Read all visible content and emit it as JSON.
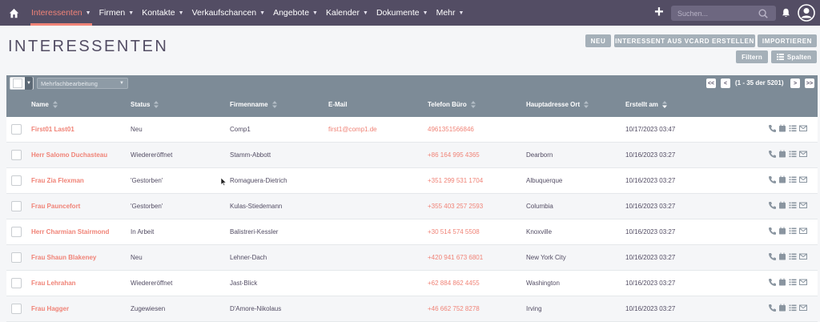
{
  "nav": {
    "items": [
      {
        "label": "Interessenten",
        "active": true
      },
      {
        "label": "Firmen",
        "active": false
      },
      {
        "label": "Kontakte",
        "active": false
      },
      {
        "label": "Verkaufschancen",
        "active": false
      },
      {
        "label": "Angebote",
        "active": false
      },
      {
        "label": "Kalender",
        "active": false
      },
      {
        "label": "Dokumente",
        "active": false
      },
      {
        "label": "Mehr",
        "active": false
      }
    ],
    "search_placeholder": "Suchen...",
    "icons": [
      "home-icon",
      "plus-icon",
      "search-icon",
      "bell-icon",
      "user-icon"
    ]
  },
  "page": {
    "title": "INTERESSENTEN",
    "buttons": {
      "new": "NEU",
      "vcard": "INTERESSENT AUS VCARD ERSTELLEN",
      "import": "IMPORTIEREN",
      "filter": "Filtern",
      "columns": "Spalten"
    }
  },
  "listbar": {
    "bulk_action": "Mehrfachbearbeitung",
    "pagination": {
      "first": "<<",
      "prev": "<",
      "text": "(1 - 35 der 5201)",
      "next": ">",
      "last": ">>"
    }
  },
  "table": {
    "headers": {
      "name": "Name",
      "status": "Status",
      "company": "Firmenname",
      "email": "E-Mail",
      "phone": "Telefon Büro",
      "city": "Hauptadresse Ort",
      "created": "Erstellt am"
    },
    "rows": [
      {
        "name": "First01 Last01",
        "status": "Neu",
        "company": "Comp1",
        "email": "first1@comp1.de",
        "phone": "4961351566846",
        "city": "",
        "created": "10/17/2023 03:47"
      },
      {
        "name": "Herr Salomo Duchasteau",
        "status": "Wiedereröffnet",
        "company": "Stamm-Abbott",
        "email": "",
        "phone": "+86 164 995 4365",
        "city": "Dearborn",
        "created": "10/16/2023 03:27"
      },
      {
        "name": "Frau Zia Flexman",
        "status": "'Gestorben'",
        "company": "Romaguera-Dietrich",
        "email": "",
        "phone": "+351 299 531 1704",
        "city": "Albuquerque",
        "created": "10/16/2023 03:27"
      },
      {
        "name": "Frau Pauncefort",
        "status": "'Gestorben'",
        "company": "Kulas-Stiedemann",
        "email": "",
        "phone": "+355 403 257 2593",
        "city": "Columbia",
        "created": "10/16/2023 03:27"
      },
      {
        "name": "Herr Charmian Stairmond",
        "status": "In Arbeit",
        "company": "Balistreri-Kessler",
        "email": "",
        "phone": "+30 514 574 5508",
        "city": "Knoxville",
        "created": "10/16/2023 03:27"
      },
      {
        "name": "Frau Shaun Blakeney",
        "status": "Neu",
        "company": "Lehner-Dach",
        "email": "",
        "phone": "+420 941 673 6801",
        "city": "New York City",
        "created": "10/16/2023 03:27"
      },
      {
        "name": "Frau Lehrahan",
        "status": "Wiedereröffnet",
        "company": "Jast-Blick",
        "email": "",
        "phone": "+62 884 862 4455",
        "city": "Washington",
        "created": "10/16/2023 03:27"
      },
      {
        "name": "Frau Hagger",
        "status": "Zugewiesen",
        "company": "D'Amore-Nikolaus",
        "email": "",
        "phone": "+46 662 752 8278",
        "city": "Irving",
        "created": "10/16/2023 03:27"
      }
    ],
    "row_icons": [
      "phone-icon",
      "calendar-icon",
      "tasks-icon",
      "email-icon"
    ]
  },
  "colors": {
    "nav_bg": "#534d64",
    "accent": "#f08377",
    "header_bg": "#7d8b97",
    "button_bg": "#a5b0b9"
  }
}
